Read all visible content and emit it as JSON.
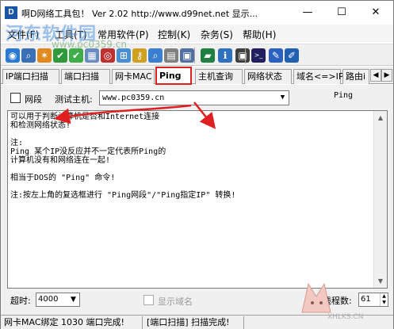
{
  "window": {
    "title": "啊D网络工具包！ Ver 2.02   http://www.d99net.net   显示...",
    "icon_label": "D",
    "min_glyph": "—",
    "max_glyph": "☐",
    "close_glyph": "✕"
  },
  "watermark": {
    "logo_text": "河东软件园",
    "url_text": "www.pc0359.cn",
    "corner_text": "XHLKS.CN"
  },
  "menu": {
    "items": [
      "文件(F)",
      "工具(T)",
      "常用软件(P)",
      "控制(K)",
      "杂务(S)",
      "帮助(H)"
    ]
  },
  "toolbar": {
    "icons": [
      {
        "name": "globe-icon",
        "color": "#2a7ad5",
        "glyph": "◉"
      },
      {
        "name": "search-icon",
        "color": "#3b6fb6",
        "glyph": "⌕"
      },
      {
        "name": "star-icon",
        "color": "#e08a1e",
        "glyph": "✶"
      },
      {
        "name": "check-icon",
        "color": "#2e9a3a",
        "glyph": "✔"
      },
      {
        "name": "check-green-icon",
        "color": "#3fae4a",
        "glyph": "✔"
      },
      {
        "name": "chart-icon",
        "color": "#6a8bc0",
        "glyph": "▦"
      },
      {
        "name": "target-icon",
        "color": "#c03030",
        "glyph": "◎"
      },
      {
        "name": "network-icon",
        "color": "#4a90d0",
        "glyph": "⊞"
      },
      {
        "name": "key-icon",
        "color": "#d0a020",
        "glyph": "⚷"
      },
      {
        "name": "magnify-icon",
        "color": "#3b7fd0",
        "glyph": "⌕"
      },
      {
        "name": "grid-icon",
        "color": "#808080",
        "glyph": "▤"
      },
      {
        "name": "monitor-icon",
        "color": "#5070a0",
        "glyph": "▣"
      },
      {
        "name": "terminal-icon",
        "color": "#208040",
        "glyph": "▰"
      },
      {
        "name": "info-icon",
        "color": "#3070c0",
        "glyph": "ℹ"
      },
      {
        "name": "screen-icon",
        "color": "#404040",
        "glyph": "▣"
      },
      {
        "name": "cmd-icon",
        "color": "#202060",
        "glyph": ">_"
      },
      {
        "name": "pen-icon",
        "color": "#2a60c0",
        "glyph": "✎"
      },
      {
        "name": "dropper-icon",
        "color": "#2060b0",
        "glyph": "✐"
      }
    ]
  },
  "tabs": [
    {
      "label": "IP端口扫描"
    },
    {
      "label": "端口扫描"
    },
    {
      "label": "网卡MAC"
    },
    {
      "label": "Ping",
      "active": true
    },
    {
      "label": "主机查询"
    },
    {
      "label": "网络状态"
    },
    {
      "label": "域名<=>IP"
    },
    {
      "label": "路由i"
    }
  ],
  "tab_scroll": {
    "left": "◀",
    "right": "▶"
  },
  "controls": {
    "segment_label": "网段",
    "host_label": "测试主机:",
    "host_value": "www.pc0359.cn",
    "dropdown_glyph": "▼",
    "ping_label": "Ping"
  },
  "output": {
    "lines": [
      "可以用于判断计算机是否和Internet连接",
      "和检测网络状态!",
      "",
      "注:",
      "Ping 某个IP没反应并不一定代表所Ping的",
      "计算机没有和网络连在一起!",
      "",
      "相当于DOS的 \"Ping\" 命令!",
      "",
      "注:按左上角的复选框进行 \"Ping网段\"/\"Ping指定IP\" 转换!"
    ],
    "scroll_up": "▲",
    "scroll_down": "▼"
  },
  "bottom": {
    "timeout_label": "超时:",
    "timeout_value": "4000",
    "show_domain_label": "显示域名",
    "threads_label": "线程数:",
    "threads_value": "61"
  },
  "status": {
    "left": "网卡MAC绑定 1030 端口完成!",
    "right": "[端口扫描] 扫描完成!"
  },
  "annotation_color": "#e02020"
}
